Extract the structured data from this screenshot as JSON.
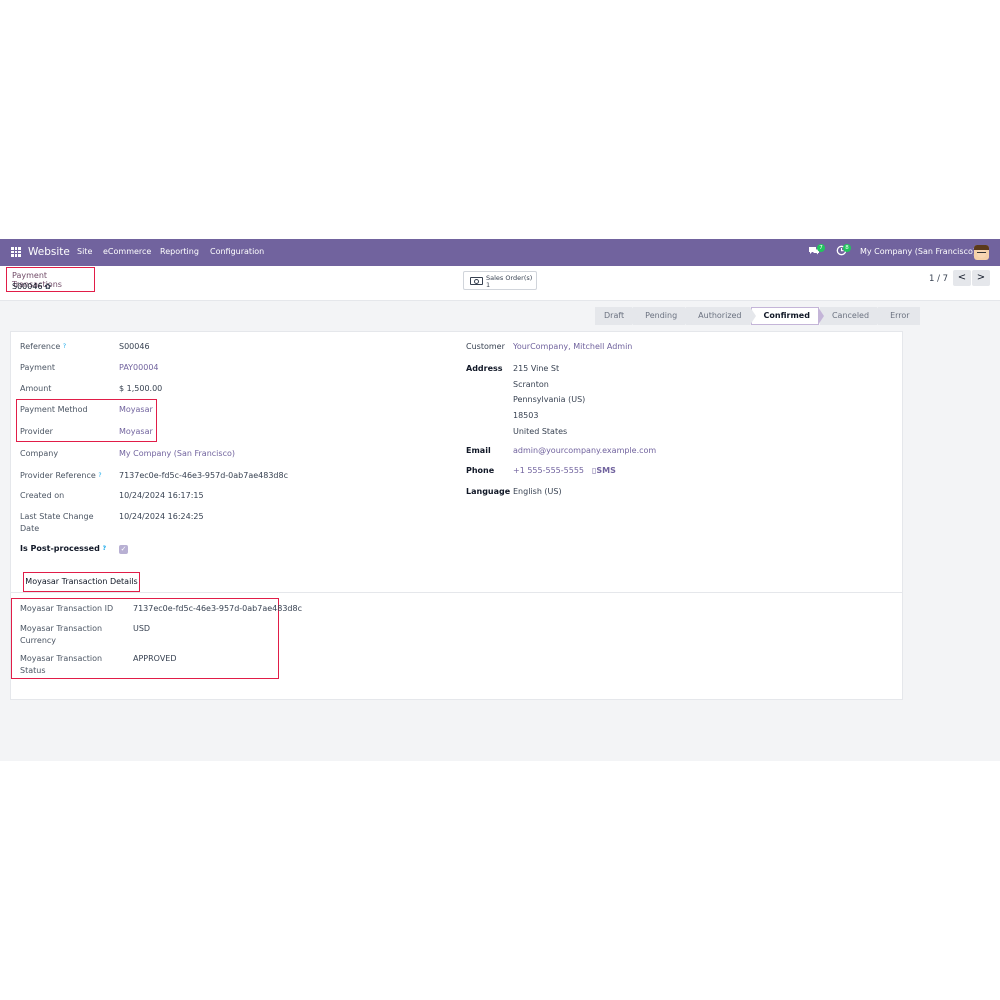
{
  "navbar": {
    "brand": "Website",
    "menu": [
      "Site",
      "eCommerce",
      "Reporting",
      "Configuration"
    ],
    "messages_badge": "7",
    "activity_badge": "8",
    "company": "My Company (San Francisco)"
  },
  "breadcrumb": {
    "parent": "Payment Transactions",
    "current": "S00046"
  },
  "smart_button": {
    "label": "Sales Order(s)",
    "value": "1"
  },
  "pager": {
    "text": "1 / 7",
    "prev": "<",
    "next": ">"
  },
  "status_bar": {
    "stages": [
      "Draft",
      "Pending",
      "Authorized",
      "Confirmed",
      "Canceled",
      "Error"
    ],
    "active": "Confirmed"
  },
  "form": {
    "left": {
      "reference_label": "Reference",
      "reference": "S00046",
      "payment_label": "Payment",
      "payment": "PAY00004",
      "amount_label": "Amount",
      "amount": "$ 1,500.00",
      "payment_method_label": "Payment Method",
      "payment_method": "Moyasar",
      "provider_label": "Provider",
      "provider": "Moyasar",
      "company_label": "Company",
      "company": "My Company (San Francisco)",
      "provider_reference_label": "Provider Reference",
      "provider_reference": "7137ec0e-fd5c-46e3-957d-0ab7ae483d8c",
      "created_on_label": "Created on",
      "created_on": "10/24/2024 16:17:15",
      "last_state_change_label_1": "Last State Change",
      "last_state_change_label_2": "Date",
      "last_state_change": "10/24/2024 16:24:25",
      "is_post_processed_label": "Is Post-processed",
      "is_post_processed": true
    },
    "right": {
      "customer_label": "Customer",
      "customer": "YourCompany, Mitchell Admin",
      "address_label": "Address",
      "address_lines": [
        "215 Vine St",
        "Scranton",
        "Pennsylvania (US)",
        "18503",
        "United States"
      ],
      "email_label": "Email",
      "email": "admin@yourcompany.example.com",
      "phone_label": "Phone",
      "phone": "+1 555-555-5555",
      "sms": "SMS",
      "language_label": "Language",
      "language": "English (US)"
    },
    "help_mark": "?",
    "tab": "Moyasar Transaction Details",
    "moyasar": {
      "transaction_id_label": "Moyasar Transaction ID",
      "transaction_id": "7137ec0e-fd5c-46e3-957d-0ab7ae483d8c",
      "currency_label_1": "Moyasar Transaction",
      "currency_label_2": "Currency",
      "currency": "USD",
      "status_label_1": "Moyasar Transaction",
      "status_label_2": "Status",
      "status": "APPROVED"
    }
  },
  "colors": {
    "navbar": "#71639e",
    "link": "#71639e",
    "highlight_box": "#e11d48",
    "badge": "#22c55e"
  }
}
